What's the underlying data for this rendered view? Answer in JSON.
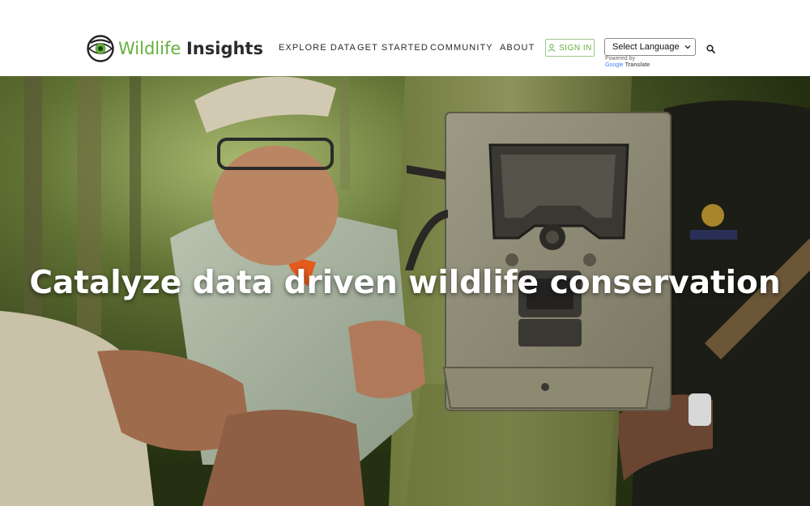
{
  "brand": {
    "name_part1": "Wildlife",
    "name_part2": "Insights"
  },
  "nav": {
    "items": [
      {
        "label": "EXPLORE DATA"
      },
      {
        "label": "GET STARTED"
      },
      {
        "label": "COMMUNITY"
      },
      {
        "label": "ABOUT"
      }
    ],
    "sign_in_label": "SIGN IN",
    "language_select": {
      "selected": "Select Language"
    },
    "powered_by": "Powered by",
    "translate_brand": "Google",
    "translate_label": "Translate",
    "search_icon": "search-icon"
  },
  "hero": {
    "headline": "Catalyze data driven wildlife conservation"
  },
  "colors": {
    "brand_green": "#64b03d",
    "text_dark": "#2b2b2b"
  }
}
